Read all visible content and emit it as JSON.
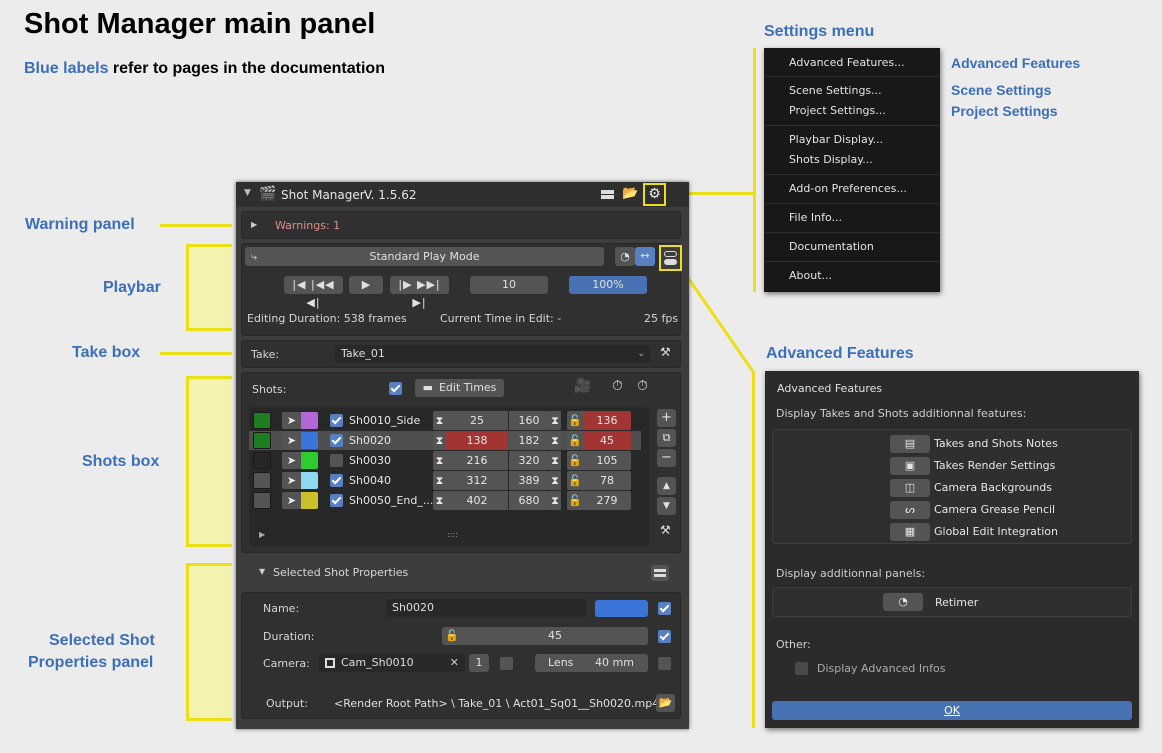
{
  "title": "Shot Manager main panel",
  "subtitle": {
    "blue": "Blue labels",
    "rest": " refer to pages in the documentation"
  },
  "labels": {
    "warning_panel": "Warning panel",
    "playbar": "Playbar",
    "take_box": "Take box",
    "shots_box": "Shots box",
    "selected_shot_1": "Selected Shot",
    "selected_shot_2": "Properties panel",
    "settings_menu": "Settings menu",
    "advanced_features_title": "Advanced Features",
    "adv_features_link": "Advanced Features",
    "scene_settings_link": "Scene Settings",
    "project_settings_link": "Project Settings"
  },
  "panel": {
    "name": "Shot Manager",
    "version": "V. 1.5.62",
    "warnings": "Warnings: 1",
    "play_mode": "Standard Play Mode",
    "frame_step": "10",
    "speed": "100%",
    "editing_duration": "Editing Duration: 538 frames",
    "current_time": "Current Time in Edit: -",
    "fps": "25 fps",
    "take_label": "Take:",
    "take_value": "Take_01",
    "shots_label": "Shots:",
    "edit_times": "Edit Times",
    "shots": [
      {
        "name": "Sh0010_Side",
        "start": "25",
        "end": "160",
        "dur": "136",
        "color": "#b266d8",
        "camcolor": "#1e7d1e",
        "enabled": true,
        "startred": false,
        "durred": true,
        "selected": false
      },
      {
        "name": "Sh0020",
        "start": "138",
        "end": "182",
        "dur": "45",
        "color": "#3c75d9",
        "camcolor": "#1e7d1e",
        "enabled": true,
        "startred": true,
        "durred": true,
        "selected": true
      },
      {
        "name": "Sh0030",
        "start": "216",
        "end": "320",
        "dur": "105",
        "color": "#2fcc2f",
        "camcolor": "#262626",
        "enabled": false,
        "startred": false,
        "durred": false,
        "selected": false
      },
      {
        "name": "Sh0040",
        "start": "312",
        "end": "389",
        "dur": "78",
        "color": "#8fd9f2",
        "camcolor": "#545454",
        "enabled": true,
        "startred": false,
        "durred": false,
        "selected": false
      },
      {
        "name": "Sh0050_End_...",
        "start": "402",
        "end": "680",
        "dur": "279",
        "color": "#c9c12a",
        "camcolor": "#545454",
        "enabled": true,
        "startred": false,
        "durred": false,
        "selected": false
      }
    ],
    "grip": "::::",
    "selected_props": "Selected Shot Properties",
    "name_label": "Name:",
    "name_value": "Sh0020",
    "duration_label": "Duration:",
    "duration_value": "45",
    "camera_label": "Camera:",
    "camera_value": "Cam_Sh0010",
    "camera_users": "1",
    "lens_label": "Lens",
    "lens_value": "40 mm",
    "output_label": "Output:",
    "output_value": "<Render Root Path> \\ Take_01 \\ Act01_Sq01__Sh0020.mp4"
  },
  "menu": {
    "items": [
      "Advanced Features...",
      "Scene Settings...",
      "Project Settings...",
      "Playbar Display...",
      "Shots Display...",
      "Add-on Preferences...",
      "File Info...",
      "Documentation",
      "About..."
    ]
  },
  "adv": {
    "title": "Advanced Features",
    "section1": "Display Takes and Shots additionnal features:",
    "features": [
      "Takes and Shots Notes",
      "Takes Render Settings",
      "Camera Backgrounds",
      "Camera Grease Pencil",
      "Global Edit Integration"
    ],
    "section2": "Display additionnal panels:",
    "retimer": "Retimer",
    "section3": "Other:",
    "adv_infos": "Display Advanced Infos",
    "ok": "OK"
  }
}
